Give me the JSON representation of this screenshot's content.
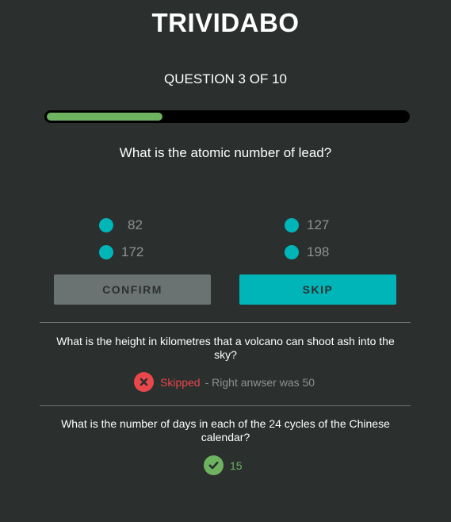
{
  "app": {
    "title": "TRIVIDABO"
  },
  "quiz": {
    "counter": "QUESTION 3 OF 10",
    "progress_fraction": 0.32,
    "question": "What is the atomic number of lead?",
    "options": [
      "82",
      "127",
      "172",
      "198"
    ],
    "confirm_label": "CONFIRM",
    "skip_label": "SKIP"
  },
  "history": [
    {
      "question": "What is the height in kilometres that a volcano can shoot ash into the sky?",
      "status": "Skipped",
      "note": "- Right anwser was 50"
    },
    {
      "question": "What is the number of days in each of the 24 cycles of the Chinese calendar?",
      "answer": "15"
    }
  ],
  "colors": {
    "background": "#2b2f2e",
    "accent": "#00b5b8",
    "success": "#6db360",
    "error": "#e8474b",
    "muted": "#8e9290"
  },
  "icons": {
    "wrong": "x-icon",
    "right": "check-icon"
  }
}
